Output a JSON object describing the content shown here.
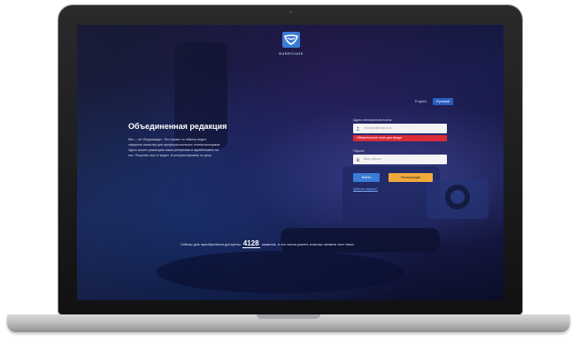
{
  "brand": {
    "name": "BARRICADE"
  },
  "language": {
    "options": [
      "English",
      "Русский"
    ],
    "selected": "Русский"
  },
  "hero": {
    "title": "Объединенная редакция",
    "description": [
      "Мы — не «Баррикада». Это сервис по обмену видео",
      "эфирного качества для профессиональных телевизионщиков.",
      "Здесь можно размещать ваши репортажи и зарабатывать на",
      "них. Покупать чьи-то видео. И ретранслировать по десу."
    ]
  },
  "login": {
    "email_label": "Адрес электронной почты",
    "email_placeholder": "example@mail.com",
    "error_message": "Обязательное поле для ввода",
    "password_label": "Пароль",
    "password_placeholder": "Ваш пароль",
    "login_button": "Войти",
    "register_button": "Регистрация",
    "forgot_link": "Забыли пароль?"
  },
  "status": {
    "prefix": "Сейчас для приобретения доступны",
    "count": "4128",
    "suffix": "сюжетов, и это число растет, пока вы читаете этот текст."
  },
  "colors": {
    "accent": "#3a7bd5",
    "error": "#d92b3a",
    "register": "#f2a93b",
    "background": "#111b45"
  },
  "icons": [
    "logo-icon",
    "user-icon",
    "lock-icon"
  ]
}
